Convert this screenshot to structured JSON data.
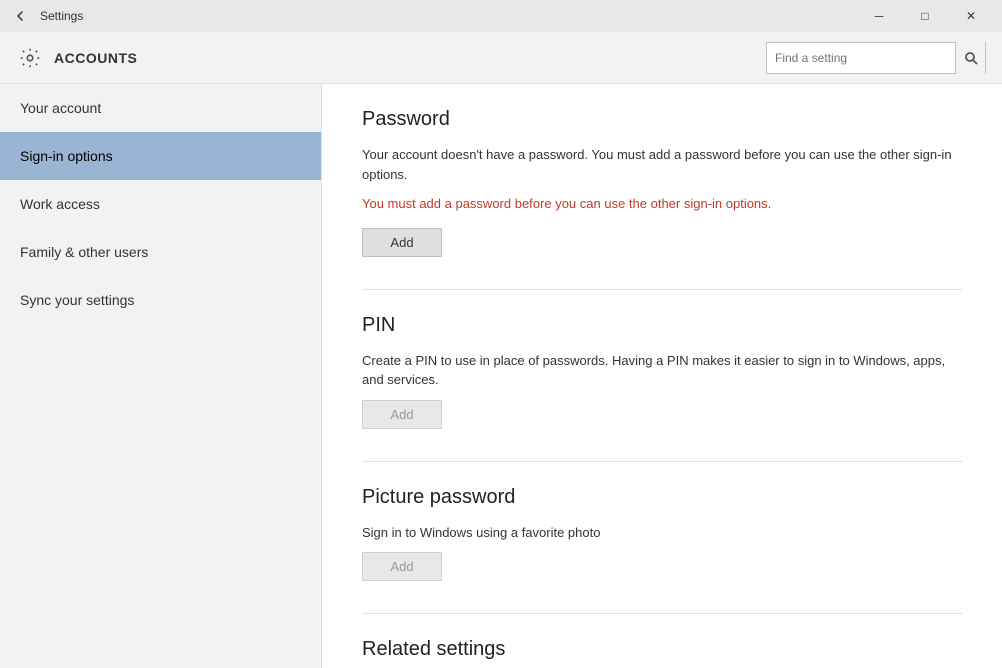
{
  "titlebar": {
    "title": "Settings",
    "back_icon": "←",
    "minimize_icon": "─",
    "maximize_icon": "□",
    "close_icon": "✕"
  },
  "header": {
    "title": "ACCOUNTS",
    "search_placeholder": "Find a setting"
  },
  "sidebar": {
    "items": [
      {
        "id": "your-account",
        "label": "Your account",
        "active": false
      },
      {
        "id": "sign-in-options",
        "label": "Sign-in options",
        "active": true
      },
      {
        "id": "work-access",
        "label": "Work access",
        "active": false
      },
      {
        "id": "family-other-users",
        "label": "Family & other users",
        "active": false
      },
      {
        "id": "sync-settings",
        "label": "Sync your settings",
        "active": false
      }
    ]
  },
  "content": {
    "sections": [
      {
        "id": "password",
        "title": "Password",
        "description": "Your account doesn't have a password. You must add a password before you can use the other sign-in options.",
        "warning": "You must add a password before you can use the other sign-in options.",
        "button_label": "Add",
        "button_disabled": false
      },
      {
        "id": "pin",
        "title": "PIN",
        "description": "Create a PIN to use in place of passwords. Having a PIN makes it easier to sign in to Windows, apps, and services.",
        "warning": null,
        "button_label": "Add",
        "button_disabled": true
      },
      {
        "id": "picture-password",
        "title": "Picture password",
        "description": "Sign in to Windows using a favorite photo",
        "warning": null,
        "button_label": "Add",
        "button_disabled": true
      },
      {
        "id": "related-settings",
        "title": "Related settings",
        "description": null,
        "warning": null,
        "button_label": null,
        "button_disabled": false
      }
    ]
  }
}
